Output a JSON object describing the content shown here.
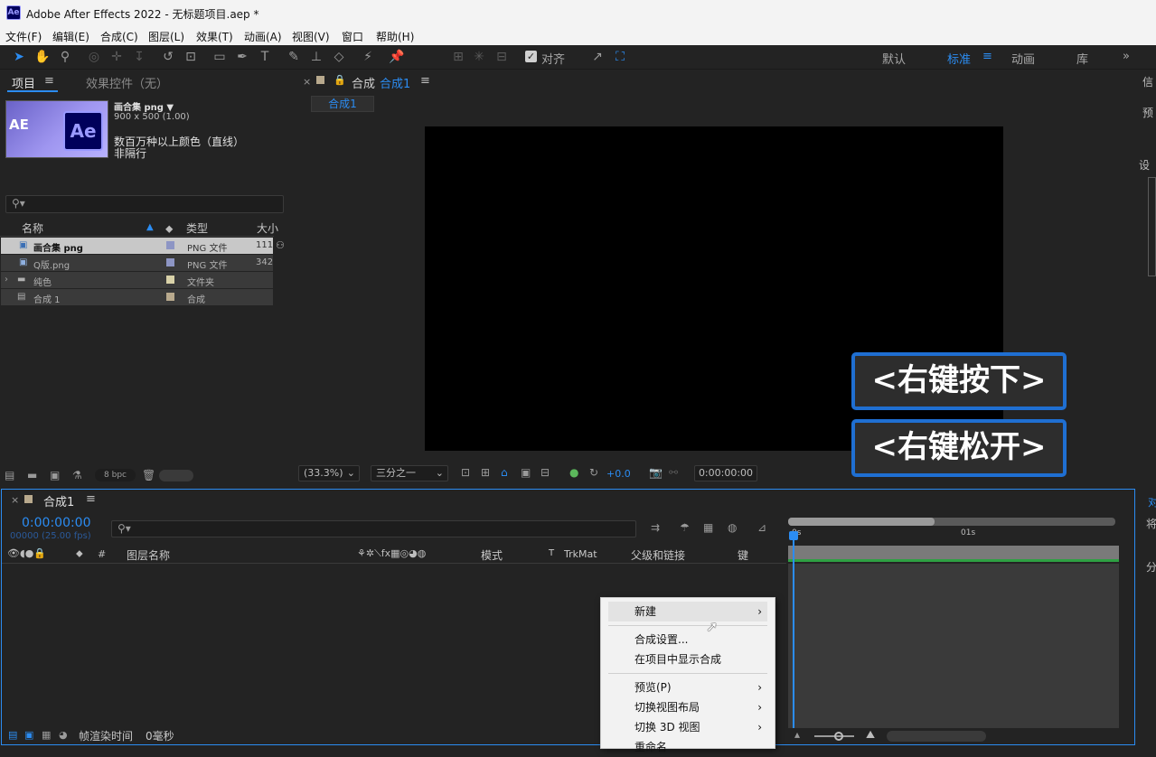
{
  "window": {
    "title": "Adobe After Effects 2022 - 无标题项目.aep *",
    "app_icon": "Ae"
  },
  "menubar": [
    "文件(F)",
    "编辑(E)",
    "合成(C)",
    "图层(L)",
    "效果(T)",
    "动画(A)",
    "视图(V)",
    "窗口",
    "帮助(H)"
  ],
  "toolbar": {
    "align_label": "对齐",
    "workspaces": [
      "默认",
      "标准",
      "动画",
      "库"
    ],
    "active_workspace": "标准"
  },
  "project": {
    "tab_project": "项目",
    "tab_effects": "效果控件（无）",
    "asset_name": "画合集 png ▼",
    "asset_dims": "900 x 500 (1.00)",
    "asset_colors": "数百万种以上颜色（直线）",
    "asset_interlace": "非隔行",
    "search_placeholder": "",
    "columns": {
      "name": "名称",
      "type": "类型",
      "size": "大小"
    },
    "items": [
      {
        "name": "画合集 png",
        "type": "PNG 文件",
        "size": "111",
        "color": "#8d95c4"
      },
      {
        "name": "Q版.png",
        "type": "PNG 文件",
        "size": "342",
        "color": "#8d95c4"
      },
      {
        "name": "纯色",
        "type": "文件夹",
        "size": "",
        "color": "#d8d1a8"
      },
      {
        "name": "合成 1",
        "type": "合成",
        "size": "",
        "color": "#b8a98d"
      }
    ],
    "bpc": "8 bpc"
  },
  "viewer": {
    "tab_prefix": "合成",
    "tab_name": "合成1",
    "breadcrumb": "合成1",
    "zoom": "(33.3%)",
    "resolution": "三分之一",
    "exposure": "+0.0",
    "timecode": "0:00:00:00"
  },
  "overlays": {
    "press": "<右键按下>",
    "release": "<右键松开>"
  },
  "timeline": {
    "tab": "合成1",
    "timecode": "0:00:00:00",
    "fps": "00000 (25.00 fps)",
    "col_layer_name": "图层名称",
    "col_mode": "模式",
    "col_t": "T",
    "col_trkmat": "TrkMat",
    "col_parent": "父级和链接",
    "col_key": "键",
    "ruler_0": "0s",
    "ruler_1": "01s",
    "render_time_label": "帧渲染时间",
    "render_time_value": "0毫秒"
  },
  "context_menu": {
    "items": [
      {
        "label": "新建",
        "submenu": true
      },
      {
        "label": "合成设置...",
        "submenu": false
      },
      {
        "label": "在项目中显示合成",
        "submenu": false
      },
      {
        "label": "预览(P)",
        "submenu": true
      },
      {
        "label": "切换视图布局",
        "submenu": true
      },
      {
        "label": "切换 3D 视图",
        "submenu": true
      },
      {
        "label": "重命名",
        "submenu": false
      }
    ]
  },
  "right_panel": {
    "label1": "信",
    "label2": "预",
    "label3": "设",
    "label4": "对",
    "label5": "将",
    "label6": "分"
  },
  "colors": {
    "accent": "#2b8cf2",
    "overlay_border": "#1f6fd2"
  }
}
